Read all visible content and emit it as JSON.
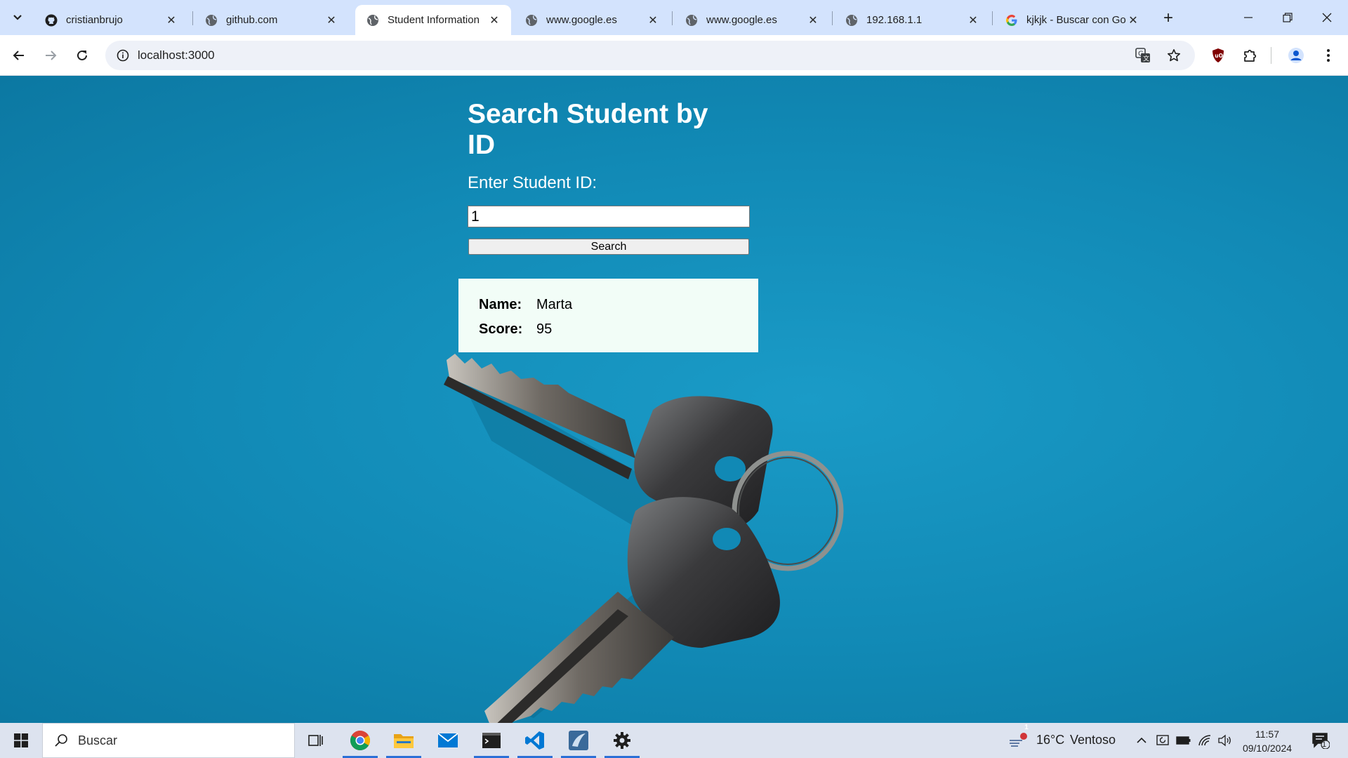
{
  "browser": {
    "tabs": [
      {
        "title": "cristianbrujo",
        "favicon": "github-icon",
        "active": false
      },
      {
        "title": "github.com",
        "favicon": "globe-icon",
        "active": false
      },
      {
        "title": "Student Information",
        "favicon": "globe-icon",
        "active": true
      },
      {
        "title": "www.google.es",
        "favicon": "globe-icon",
        "active": false
      },
      {
        "title": "www.google.es",
        "favicon": "globe-icon",
        "active": false
      },
      {
        "title": "192.168.1.1",
        "favicon": "globe-icon",
        "active": false
      },
      {
        "title": "kjkjk - Buscar con Go",
        "favicon": "google-icon",
        "active": false
      }
    ],
    "url": "localhost:3000"
  },
  "page": {
    "title": "Search Student by ID",
    "input_label": "Enter Student ID:",
    "input_value": "1",
    "search_button": "Search",
    "result": {
      "name_label": "Name:",
      "name_value": "Marta",
      "score_label": "Score:",
      "score_value": "95"
    },
    "background_color": "#1189b5",
    "card_color": "#f2fdf7"
  },
  "taskbar": {
    "search_placeholder": "Buscar",
    "weather": {
      "temperature": "16°C",
      "condition": "Ventoso",
      "alert_count": "1"
    },
    "time": "11:57",
    "date": "09/10/2024",
    "notification_count": "1"
  }
}
